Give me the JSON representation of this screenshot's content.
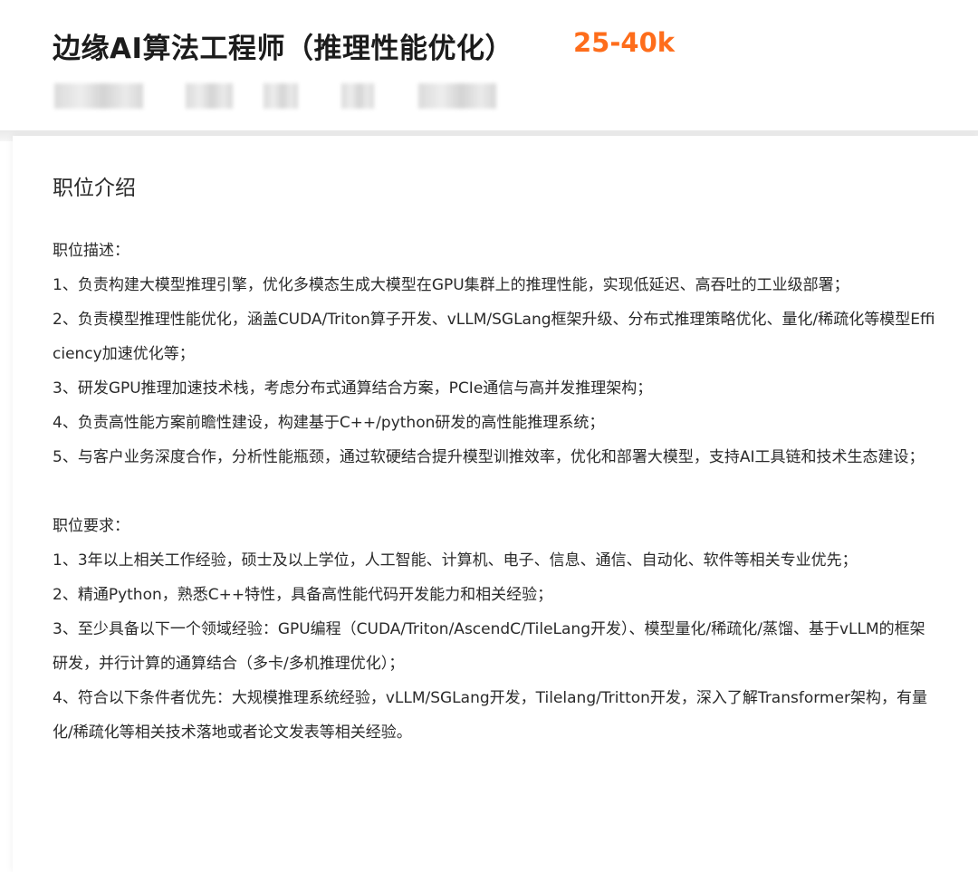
{
  "header": {
    "title": "边缘AI算法工程师（推理性能优化）",
    "salary": "25-40k"
  },
  "section": {
    "title": "职位介绍"
  },
  "description": {
    "heading": "职位描述：",
    "items": [
      "1、负责构建大模型推理引擎，优化多模态生成大模型在GPU集群上的推理性能，实现低延迟、高吞吐的工业级部署；",
      "2、负责模型推理性能优化，涵盖CUDA/Triton算子开发、vLLM/SGLang框架升级、分布式推理策略优化、量化/稀疏化等模型Efficiency加速优化等；",
      "3、研发GPU推理加速技术栈，考虑分布式通算结合方案，PCIe通信与高并发推理架构；",
      "4、负责高性能方案前瞻性建设，构建基于C++/python研发的高性能推理系统；",
      "5、与客户业务深度合作，分析性能瓶颈，通过软硬结合提升模型训推效率，优化和部署大模型，支持AI工具链和技术生态建设；"
    ]
  },
  "requirements": {
    "heading": "职位要求：",
    "items": [
      "1、3年以上相关工作经验，硕士及以上学位，人工智能、计算机、电子、信息、通信、自动化、软件等相关专业优先；",
      "2、精通Python，熟悉C++特性，具备高性能代码开发能力和相关经验；",
      "3、至少具备以下一个领域经验：GPU编程（CUDA/Triton/AscendC/TileLang开发）、模型量化/稀疏化/蒸馏、基于vLLM的框架研发，并行计算的通算结合（多卡/多机推理优化）；",
      "4、符合以下条件者优先：大规模推理系统经验，vLLM/SGLang开发，Tilelang/Tritton开发，深入了解Transformer架构，有量化/稀疏化等相关技术落地或者论文发表等相关经验。"
    ]
  },
  "colors": {
    "salary": "#fe6d1b",
    "title": "#1c1c1c",
    "body_text": "#2a2a2a"
  }
}
